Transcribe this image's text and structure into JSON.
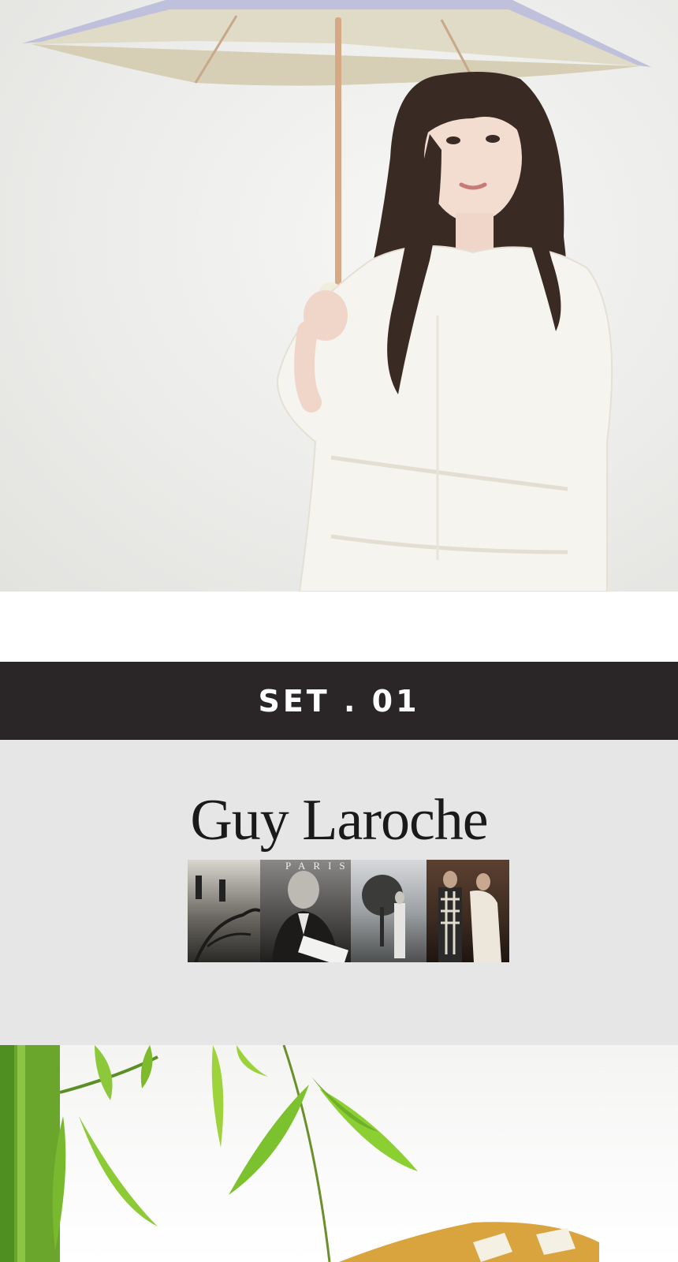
{
  "hero_photo": {
    "alt": "model holding a beige umbrella"
  },
  "set_banner": {
    "title": "SET . 01"
  },
  "brand": {
    "name": "Guy Laroche",
    "sub": "PARIS"
  },
  "collage": {
    "tiles": 4
  },
  "bamboo_photo": {
    "alt": "bamboo leaves"
  },
  "colors": {
    "banner_bg": "#2a2628",
    "brand_bg": "#e6e6e6",
    "umbrella_canopy": "#d9d2bd",
    "umbrella_rim": "#bfc0dc"
  }
}
